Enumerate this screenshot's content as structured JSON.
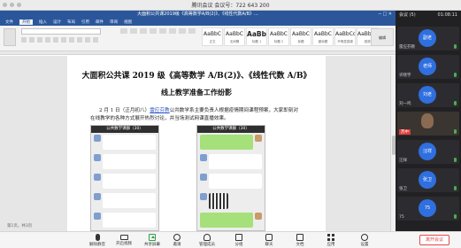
{
  "meeting": {
    "title": "腾讯会议 会议号：722 643 200",
    "timer": "01:08:11"
  },
  "word": {
    "window_title": "大面积公共课2019级《高等数学A/B(2)》、《线性代数A/B》...",
    "menu": [
      "文件",
      "开始",
      "插入",
      "设计",
      "布局",
      "引用",
      "邮件",
      "审阅",
      "视图"
    ],
    "styles": [
      {
        "preview": "AaBbC",
        "label": "正文",
        "big": false
      },
      {
        "preview": "AaBbC",
        "label": "无间隔",
        "big": false
      },
      {
        "preview": "AaBb",
        "label": "标题 1",
        "big": true
      },
      {
        "preview": "AaBbC",
        "label": "标题 2",
        "big": false
      },
      {
        "preview": "AaBbC",
        "label": "标题",
        "big": false
      },
      {
        "preview": "AaBbC",
        "label": "副标题",
        "big": false
      },
      {
        "preview": "AaBbCcD",
        "label": "不明显强调",
        "big": false
      },
      {
        "preview": "AaBbCcD",
        "label": "强调",
        "big": false
      }
    ],
    "edit_label": "编辑",
    "page_hint": "第1页，共3页"
  },
  "document": {
    "title": "大面积公共课 2019 级《高等数学 A/B(2)》、《线性代数 A/B》",
    "subtitle": "线上教学准备工作纷影",
    "para_prefix": "2 月 1 日（正月初八）",
    "para_link": "雷应芬教",
    "para_rest": "公共数学系主要负责人根据疫情期间课程预案，大家即刻对在线教学的各种方式展开热烈讨论，并当场测试网课直播效果。",
    "phones": [
      {
        "header": "公共数学课群（30）"
      },
      {
        "header": "公共数学课群（30）"
      }
    ]
  },
  "participants": {
    "header": "会议 (5)",
    "items": [
      {
        "name": "雷应芬教",
        "initials": "副老",
        "video": false
      },
      {
        "name": "许晓宇",
        "initials": "老师",
        "video": false
      },
      {
        "name": "刘一鸣",
        "initials": "刘老",
        "video": false
      },
      {
        "name": "苏中",
        "initials": "",
        "video": true
      },
      {
        "name": "汪祥",
        "initials": "汪祥",
        "video": false
      },
      {
        "name": "张卫",
        "initials": "张卫",
        "video": false
      },
      {
        "name": "75",
        "initials": "75",
        "video": false
      }
    ]
  },
  "toolbar": {
    "items": [
      {
        "label": "解除静音",
        "icon": "mic-icon"
      },
      {
        "label": "开启视频",
        "icon": "camera-icon"
      },
      {
        "label": "共享屏幕",
        "icon": "share-screen-icon"
      },
      {
        "label": "邀请",
        "icon": "invite-icon"
      },
      {
        "label": "管理成员",
        "icon": "members-icon"
      },
      {
        "label": "分组",
        "icon": "group-icon"
      },
      {
        "label": "聊天",
        "icon": "chat-icon"
      },
      {
        "label": "文档",
        "icon": "doc-icon"
      },
      {
        "label": "应用",
        "icon": "apps-icon"
      },
      {
        "label": "设置",
        "icon": "settings-icon"
      }
    ],
    "end_label": "离开会议"
  }
}
